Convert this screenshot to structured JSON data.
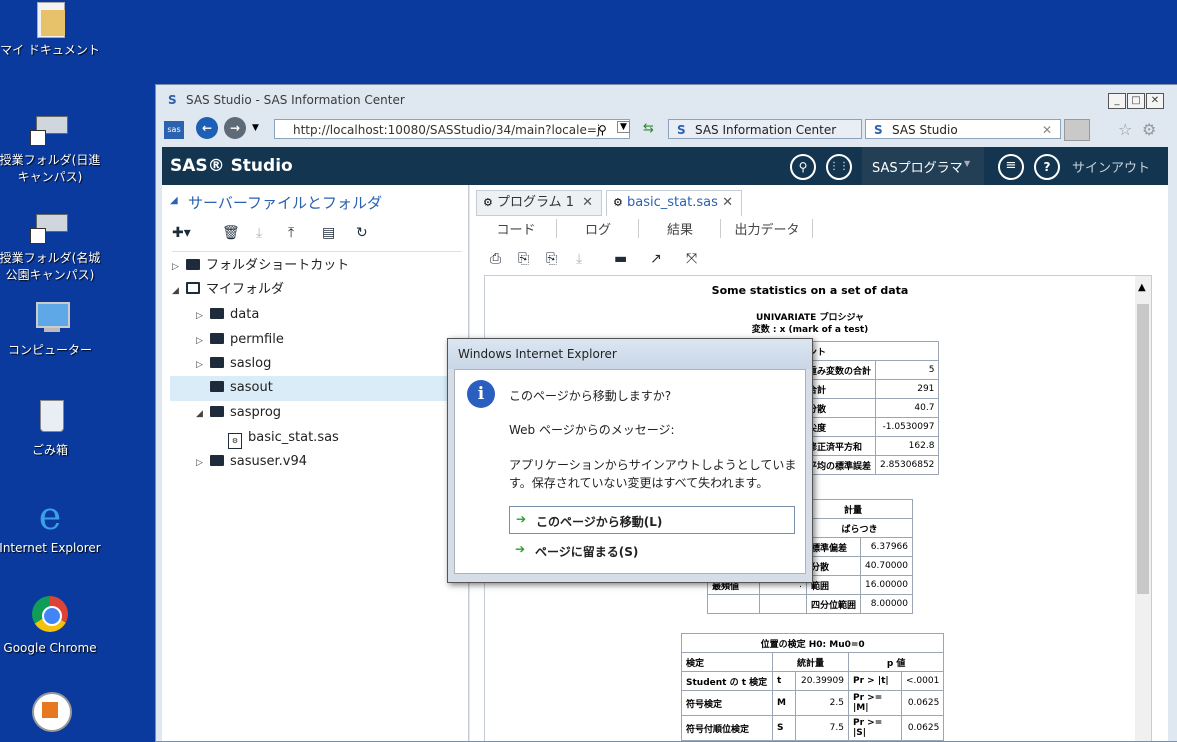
{
  "desktop": {
    "icons": [
      {
        "label": "マイ ドキュメント"
      },
      {
        "label": "授業フォルダ(日進キャンパス)"
      },
      {
        "label": "授業フォルダ(名城公園キャンパス)"
      },
      {
        "label": "コンピューター"
      },
      {
        "label": "ごみ箱"
      },
      {
        "label": "Internet Explorer"
      },
      {
        "label": "Google Chrome"
      }
    ]
  },
  "browser": {
    "title": "SAS Studio - SAS Information Center",
    "address": "http://localhost:10080/SASStudio/34/main?locale=j",
    "tabs": [
      {
        "label": "SAS Information Center"
      },
      {
        "label": "SAS Studio"
      }
    ]
  },
  "app": {
    "brand": "SAS® Studio",
    "menu_label": "SASプログラマ",
    "signout": "サインアウト"
  },
  "left_panel": {
    "title": "サーバーファイルとフォルダ",
    "tree": [
      {
        "label": "フォルダショートカット"
      },
      {
        "label": "マイフォルダ"
      },
      {
        "label": "data"
      },
      {
        "label": "permfile"
      },
      {
        "label": "saslog"
      },
      {
        "label": "sasout"
      },
      {
        "label": "sasprog"
      },
      {
        "label": "basic_stat.sas"
      },
      {
        "label": "sasuser.v94"
      }
    ]
  },
  "editor": {
    "tabs": [
      {
        "label": "プログラム 1"
      },
      {
        "label": "basic_stat.sas"
      }
    ],
    "subtabs": [
      {
        "label": "コード"
      },
      {
        "label": "ログ"
      },
      {
        "label": "結果"
      },
      {
        "label": "出力データ"
      }
    ]
  },
  "results": {
    "title": "Some statistics on a set of data",
    "proc": "UNIVARIATE プロシジャ",
    "var": "変数 : x (mark of a test)",
    "moments_header": "ント",
    "moments": [
      {
        "label": "重み変数の合計",
        "value": "5"
      },
      {
        "label": "合計",
        "value": "291"
      },
      {
        "label": "分散",
        "value": "40.7"
      },
      {
        "label": "尖度",
        "value": "-1.0530097"
      },
      {
        "label": "修正済平方和",
        "value": "162.8"
      },
      {
        "label": "平均の標準誤差",
        "value": "2.85306852"
      }
    ],
    "basic_header": "計量",
    "basic_subheader": "ばらつき",
    "basic": [
      {
        "a": "",
        "b": "",
        "label": "標準偏差",
        "value": "6.37966"
      },
      {
        "a": "",
        "b": "",
        "label": "分散",
        "value": "40.70000"
      },
      {
        "a": "最頻値",
        "b": ".",
        "label": "範囲",
        "value": "16.00000"
      },
      {
        "a": "",
        "b": "",
        "label": "四分位範囲",
        "value": "8.00000"
      }
    ],
    "loc_title": "位置の検定 H0: Mu0=0",
    "loc_headers": [
      "検定",
      "統計量",
      "p 値"
    ],
    "loc_rows": [
      {
        "test": "Student の t 検定",
        "sym": "t",
        "stat": "20.39909",
        "pl": "Pr > |t|",
        "pv": "<.0001"
      },
      {
        "test": "符号検定",
        "sym": "M",
        "stat": "2.5",
        "pl": "Pr >= |M|",
        "pv": "0.0625"
      },
      {
        "test": "符号付順位検定",
        "sym": "S",
        "stat": "7.5",
        "pl": "Pr >= |S|",
        "pv": "0.0625"
      }
    ]
  },
  "dialog": {
    "title": "Windows Internet Explorer",
    "question": "このページから移動しますか?",
    "msg_label": "Web ページからのメッセージ:",
    "message": "アプリケーションからサインアウトしようとしています。保存されていない変更はすべて失われます。",
    "leave": "このページから移動(L)",
    "stay": "ページに留まる(S)"
  }
}
